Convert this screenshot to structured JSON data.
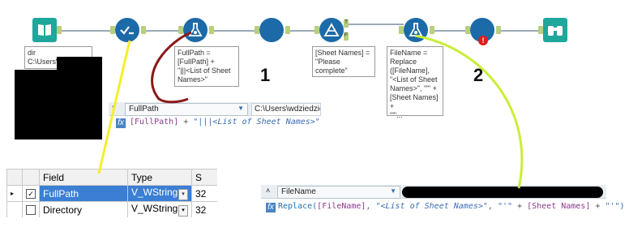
{
  "workflow": {
    "annotations": {
      "input_tool": "dir\nC:\\Users\\",
      "formula_1": "FullPath =\n[FullPath] +\n\"|||<List of Sheet\nNames>\"",
      "filter": "[Sheet Names] =\n\"Please\ncomplete\"",
      "formula_2": "FileName =\nReplace\n([FileName],\n\"<List of Sheet\nNames>\", \"'\" +\n[Sheet Names] +\n\"'\"..."
    },
    "filter_anchors": {
      "true": "T",
      "false": "F"
    },
    "error_badge": "!",
    "step_labels": [
      "1",
      "2"
    ]
  },
  "formula_panel_1": {
    "field": "FullPath",
    "path_value": "C:\\Users\\wdziedzic",
    "expr_field": "[FullPath]",
    "expr_op": " + ",
    "expr_string": "\"|||<List of Sheet Names>\""
  },
  "field_grid": {
    "columns": [
      "Field",
      "Type",
      "S"
    ],
    "rows": [
      {
        "field": "FullPath",
        "type": "V_WString",
        "size": "32",
        "selected": true,
        "checked": true
      },
      {
        "field": "Directory",
        "type": "V_WString",
        "size": "32",
        "selected": false,
        "checked": false
      }
    ]
  },
  "formula_panel_2": {
    "field": "FileName",
    "expr_fn": "Replace(",
    "expr_field": "[FileName]",
    "expr_sep": ", ",
    "expr_str1": "\"<List of Sheet Names>\"",
    "expr_sep2": ", ",
    "expr_str2": "\"'\"",
    "expr_op": " + ",
    "expr_field2": "[Sheet Names]",
    "expr_op2": " + ",
    "expr_str3": "\"'\"",
    "expr_close": ")"
  },
  "colors": {
    "tool_blue": "#1c6aa8",
    "tool_teal": "#1fa79c",
    "connector": "#9aa9b5",
    "arrow_yellow": "#f4ef2a",
    "arrow_darkred": "#8b1a1a",
    "arrow_lime": "#c9ee3a",
    "selection": "#3b7fd4",
    "error_red": "#e21b1b"
  },
  "icons": [
    "book-input-icon",
    "check-select-icon",
    "flask-formula-icon",
    "blank-tool-icon",
    "filter-triangle-icon",
    "flask-formula-icon",
    "blank-tool-icon",
    "binoculars-browse-icon"
  ]
}
